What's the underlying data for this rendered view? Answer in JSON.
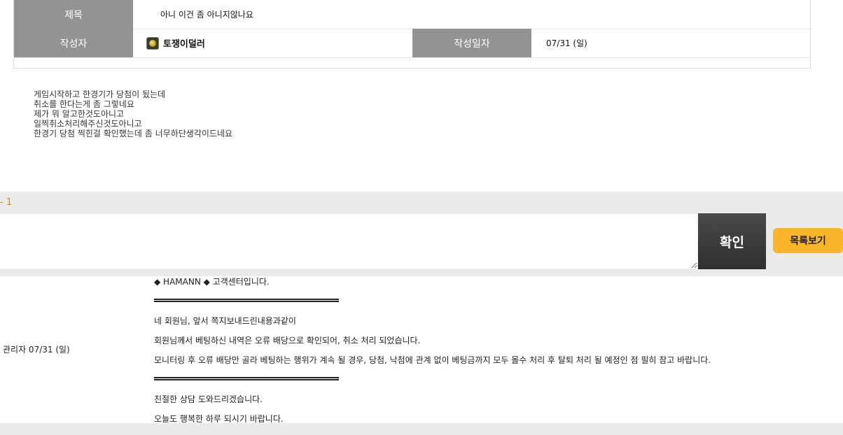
{
  "post": {
    "title_label": "제목",
    "title_value": "아니 이건 좀 아니지않나요",
    "author_label": "작성자",
    "author_name": "토쟁이덜러",
    "date_label": "작성일자",
    "date_value": "07/31 (일)",
    "body_lines": [
      "게임시작하고 한경기가 당첨이 됬는데",
      "취소를 한다는게 좀 그렇네요",
      "제가 뭐 알고한것도아니고",
      "일찍취소처리해주신것도아니고",
      "한경기 당첨 찍힌걸 확인했는데 좀 너무하단생각이드네요"
    ]
  },
  "comments": {
    "count_text": "- 1",
    "confirm_label": "확인",
    "list_label": "목록보기"
  },
  "reply": {
    "meta": "관리자 07/31 (일)",
    "header": "◆ HAMANN ◆ 고객센터입니다.",
    "line1": "네 회원님, 앞서 쪽지보내드린내용과같이",
    "line2": "회원님께서 베팅하신 내역은 오류 배당으로 확인되어, 취소 처리 되었습니다.",
    "line3": "모니터링 후 오류 배당만 골라 베팅하는 행위가 계속 될 경우, 당첨, 낙첨에 관계 없이 베팅금까지 모두 몰수 처리 후 탈퇴 처리 될 예정인 점 필히 참고 바랍니다.",
    "line4": "친절한 상담 도와드리겠습니다.",
    "line5": "오늘도 행복한 하루 되시기 바랍니다."
  }
}
